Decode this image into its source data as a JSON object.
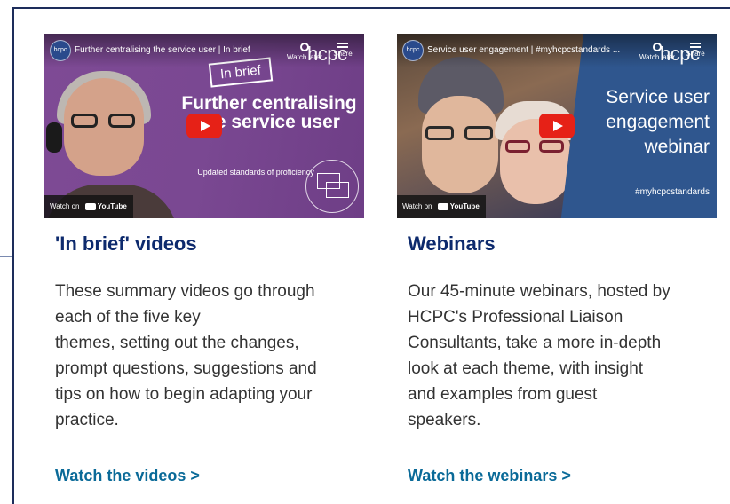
{
  "cards": [
    {
      "video": {
        "channel": "hcpc",
        "title": "Further centralising the service user | In brief",
        "watch_later": "Watch later",
        "share": "Share",
        "brand": "hcpc",
        "badge": "In brief",
        "headline": "Further centralising the service user",
        "subtext": "Updated standards of proficiency",
        "watch_on": "Watch on",
        "youtube": "YouTube"
      },
      "title": "'In brief' videos",
      "body_lines": [
        "These summary videos go through",
        "each of the five key",
        "themes, setting out the changes,",
        "prompt questions, suggestions and",
        "tips on how to begin adapting your",
        "practice."
      ],
      "link": "Watch the videos >"
    },
    {
      "video": {
        "channel": "hcpc",
        "title": "Service user engagement | #myhcpcstandards ...",
        "watch_later": "Watch later",
        "share": "Share",
        "brand": "hcpc",
        "headline_lines": [
          "Service user",
          "engagement",
          "webinar"
        ],
        "hashtag": "#myhcpcstandards",
        "watch_on": "Watch on",
        "youtube": "YouTube"
      },
      "title": "Webinars",
      "body_lines": [
        "Our 45-minute webinars, hosted by",
        "HCPC's Professional Liaison",
        "Consultants, take a more in-depth",
        "look at each theme, with insight",
        "and examples from guest",
        "speakers."
      ],
      "link": "Watch the webinars >"
    }
  ],
  "colors": {
    "title": "#0d2a6d",
    "link": "#0a6a98",
    "body": "#333333",
    "frame": "#1d2d5b",
    "thumb1_bg": "#7e4a95",
    "thumb2_bg": "#2f568e",
    "play": "#e62117"
  }
}
